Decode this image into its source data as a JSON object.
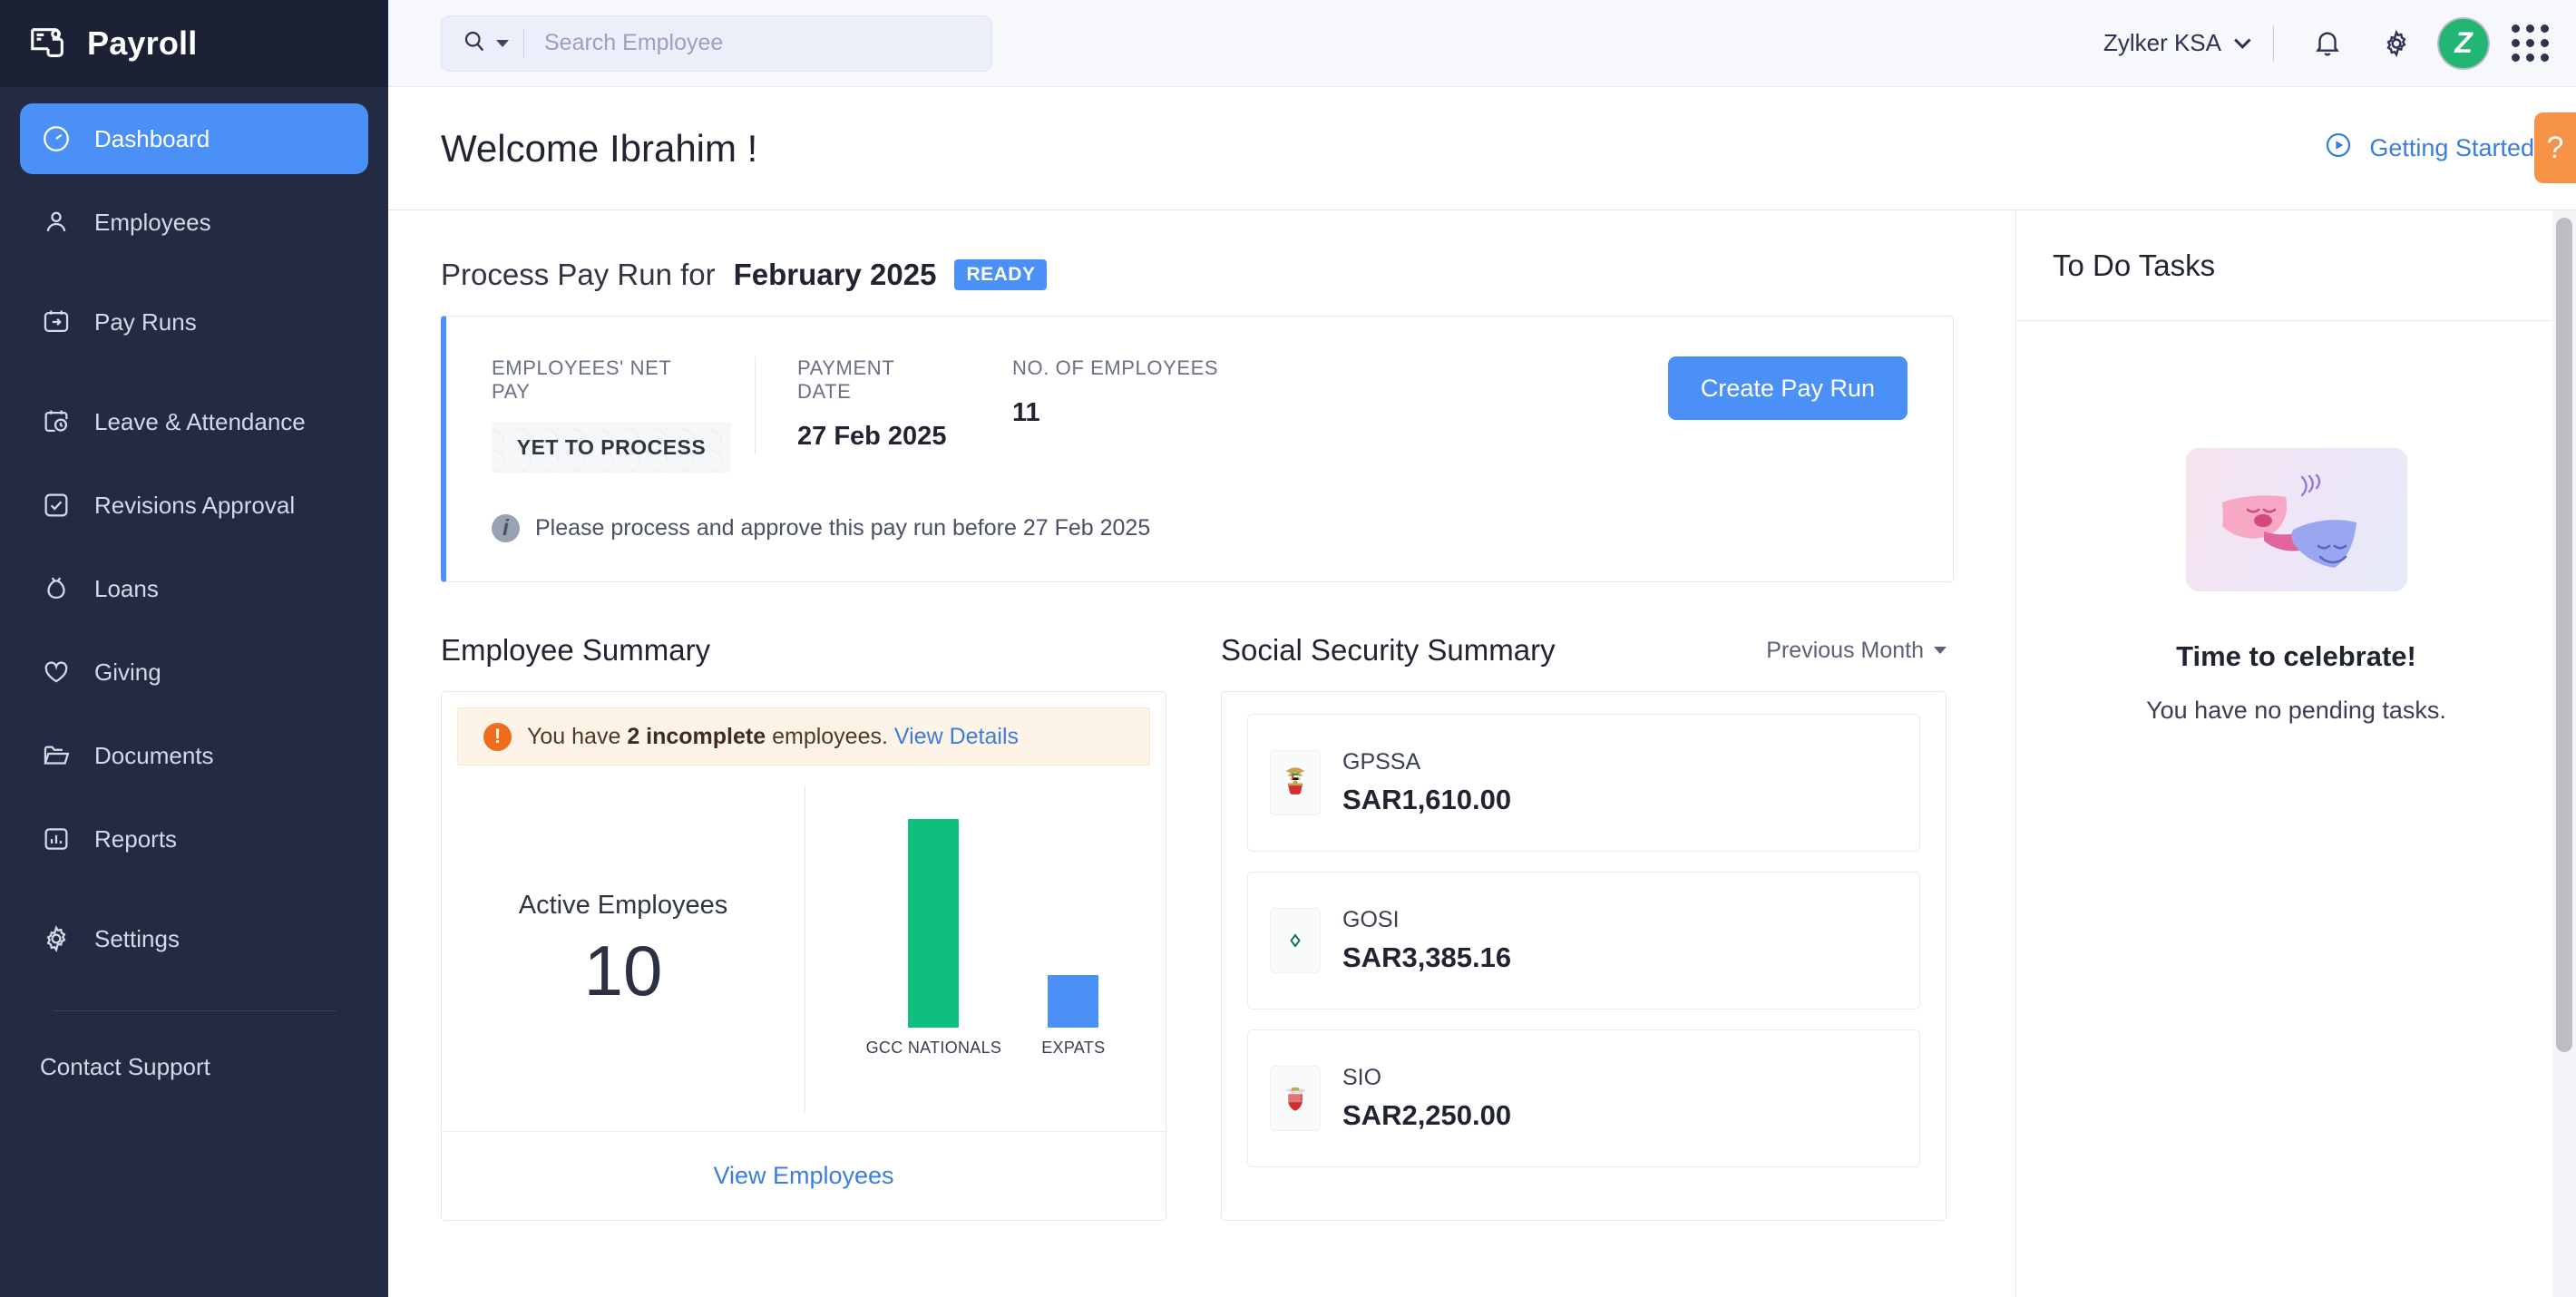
{
  "brand": {
    "title": "Payroll",
    "icon": "payroll-card-icon"
  },
  "sidebar": {
    "items": [
      {
        "label": "Dashboard",
        "icon": "gauge-icon",
        "active": true
      },
      {
        "label": "Employees",
        "icon": "person-icon",
        "active": false
      },
      {
        "label": "Pay Runs",
        "icon": "calendar-arrow-icon",
        "active": false
      },
      {
        "label": "Leave & Attendance",
        "icon": "calendar-clock-icon",
        "active": false
      },
      {
        "label": "Revisions Approval",
        "icon": "check-square-icon",
        "active": false
      },
      {
        "label": "Loans",
        "icon": "money-bag-icon",
        "active": false
      },
      {
        "label": "Giving",
        "icon": "heart-icon",
        "active": false
      },
      {
        "label": "Documents",
        "icon": "folder-icon",
        "active": false
      },
      {
        "label": "Reports",
        "icon": "bar-chart-icon",
        "active": false
      },
      {
        "label": "Settings",
        "icon": "gear-icon",
        "active": false
      }
    ],
    "support_label": "Contact Support"
  },
  "topbar": {
    "search_placeholder": "Search Employee",
    "search_value": "",
    "search_icon": "search-icon",
    "org_name": "Zylker KSA",
    "notifications_icon": "bell-icon",
    "settings_icon": "gear-icon",
    "avatar_initial": "Z",
    "apps_icon": "grid-apps-icon"
  },
  "welcome": {
    "greeting": "Welcome Ibrahim !",
    "getting_started": "Getting Started",
    "help_label": "?"
  },
  "payrun": {
    "title_prefix": "Process Pay Run for",
    "period": "February 2025",
    "status_badge": "READY",
    "net_pay_label": "EMPLOYEES' NET PAY",
    "net_pay_value": "YET TO PROCESS",
    "payment_date_label": "PAYMENT DATE",
    "payment_date_value": "27 Feb 2025",
    "employees_label": "NO. OF EMPLOYEES",
    "employees_value": "11",
    "create_button": "Create Pay Run",
    "note": "Please process and approve this pay run before 27 Feb 2025"
  },
  "employee_summary": {
    "title": "Employee Summary",
    "warning_prefix": "You have",
    "warning_count": "2 incomplete",
    "warning_suffix": "employees.",
    "warning_link": "View Details",
    "active_label": "Active Employees",
    "active_count": "10",
    "view_link": "View Employees"
  },
  "social_security": {
    "title": "Social Security Summary",
    "period_filter": "Previous Month",
    "cards": [
      {
        "name": "GPSSA",
        "amount": "SAR1,610.00",
        "icon": "uae-emblem-icon"
      },
      {
        "name": "GOSI",
        "amount": "SAR3,385.16",
        "icon": "gosi-logo-icon"
      },
      {
        "name": "SIO",
        "amount": "SAR2,250.00",
        "icon": "bahrain-emblem-icon"
      }
    ]
  },
  "todo": {
    "title": "To Do Tasks",
    "empty_title": "Time to celebrate!",
    "empty_subtitle": "You have no pending tasks."
  },
  "colors": {
    "sidebar_bg": "#232b43",
    "accent_blue": "#4a90f7",
    "green": "#0fbf7e",
    "orange": "#f79349",
    "link_blue": "#3b7ddd"
  },
  "chart_data": {
    "type": "bar",
    "title": "Active Employees",
    "categories": [
      "GCC NATIONALS",
      "EXPATS"
    ],
    "values": [
      8,
      2
    ],
    "colors": [
      "#0fbf7e",
      "#4a90f7"
    ],
    "xlabel": "",
    "ylabel": "",
    "ylim": [
      0,
      8
    ],
    "grid": false,
    "legend": "none",
    "total_label": "Active Employees",
    "total": 10
  }
}
